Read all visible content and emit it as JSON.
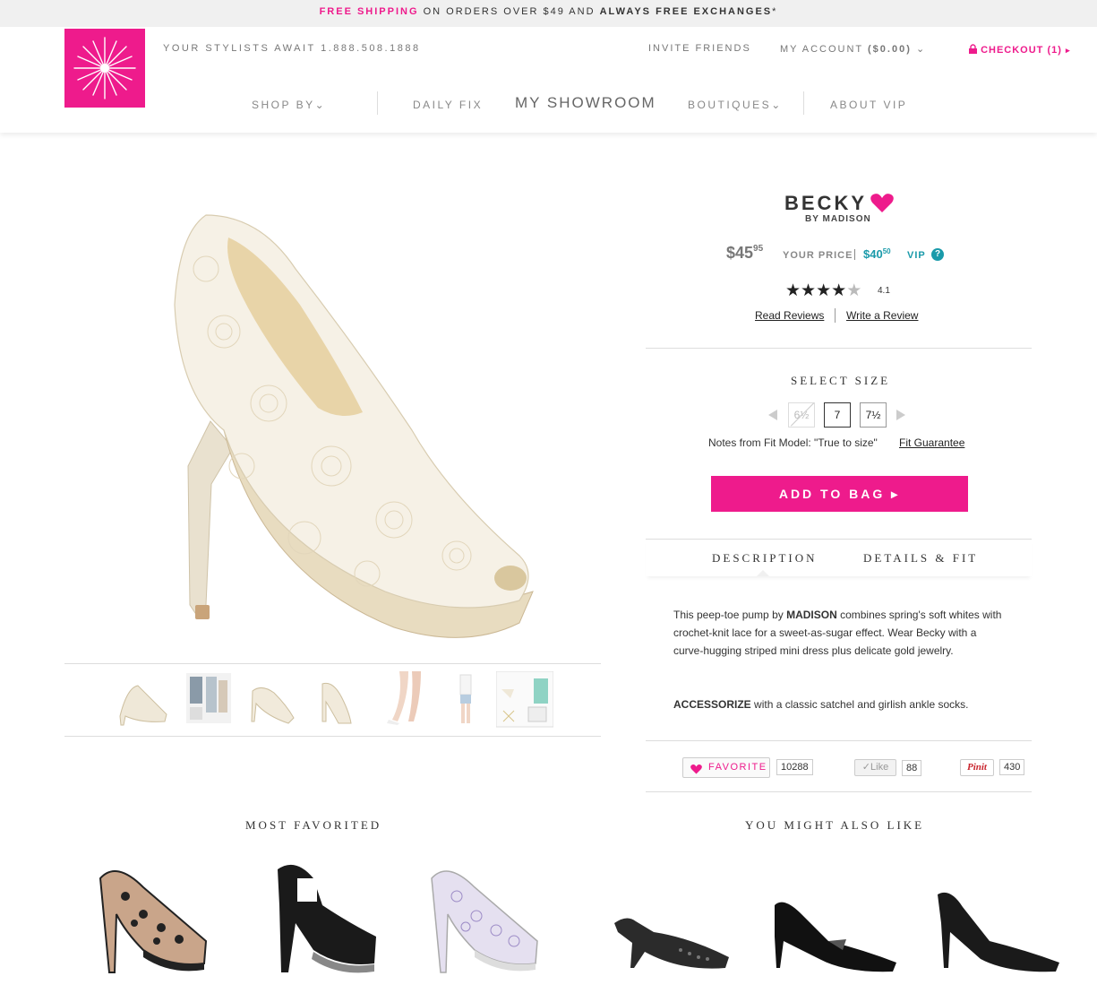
{
  "promo": {
    "highlight": "FREE SHIPPING",
    "middle": " ON ORDERS OVER $49 AND ",
    "bold": "ALWAYS FREE EXCHANGES",
    "suffix": "*"
  },
  "header": {
    "stylists": "YOUR STYLISTS AWAIT 1.888.508.1888",
    "invite": "INVITE FRIENDS",
    "account_label": "MY ACCOUNT",
    "account_balance": "($0.00)",
    "checkout": "CHECKOUT (1)",
    "nav": {
      "shop_by": "SHOP BY",
      "daily_fix": "DAILY FIX",
      "my_showroom": "MY SHOWROOM",
      "boutiques": "BOUTIQUES",
      "about_vip": "ABOUT VIP"
    }
  },
  "product": {
    "name": "BECKY",
    "brand": "BY MADISON",
    "price_main": "$45",
    "price_cents": "95",
    "your_price": "YOUR PRICE",
    "vip_main": "$40",
    "vip_cents": "50",
    "vip_label": "VIP",
    "help": "?",
    "rating": "4.1",
    "rating_stars": 4,
    "read_reviews": "Read Reviews",
    "write_review": "Write a Review",
    "select_size": "SELECT SIZE",
    "sizes": [
      {
        "label": "6½",
        "state": "unavailable"
      },
      {
        "label": "7",
        "state": "selected"
      },
      {
        "label": "7½",
        "state": "available"
      }
    ],
    "fit_note": "Notes from Fit Model: \"True to size\"",
    "fit_guarantee": "Fit Guarantee",
    "add_to_bag": "ADD TO BAG ▸",
    "tabs": [
      "DESCRIPTION",
      "DETAILS & FIT"
    ],
    "desc_pre": "This peep-toe pump by ",
    "desc_brand": "MADISON",
    "desc_post": " combines spring's soft whites with crochet-knit lace for a sweet-as-sugar effect. Wear Becky with a curve-hugging striped mini dress plus delicate gold jewelry.",
    "acc_bold": "ACCESSORIZE",
    "acc_rest": " with a classic satchel and girlish ankle socks."
  },
  "social": {
    "favorite": "FAVORITE",
    "favorite_count": "10288",
    "like": "✓Like",
    "like_count": "88",
    "pin": "Pinit",
    "pin_count": "430"
  },
  "sections": {
    "most_favorited": "MOST FAVORITED",
    "you_might_also_like": "YOU MIGHT ALSO LIKE"
  },
  "colors": {
    "brand_pink": "#ee1b8c",
    "vip_teal": "#1a9aaa"
  }
}
